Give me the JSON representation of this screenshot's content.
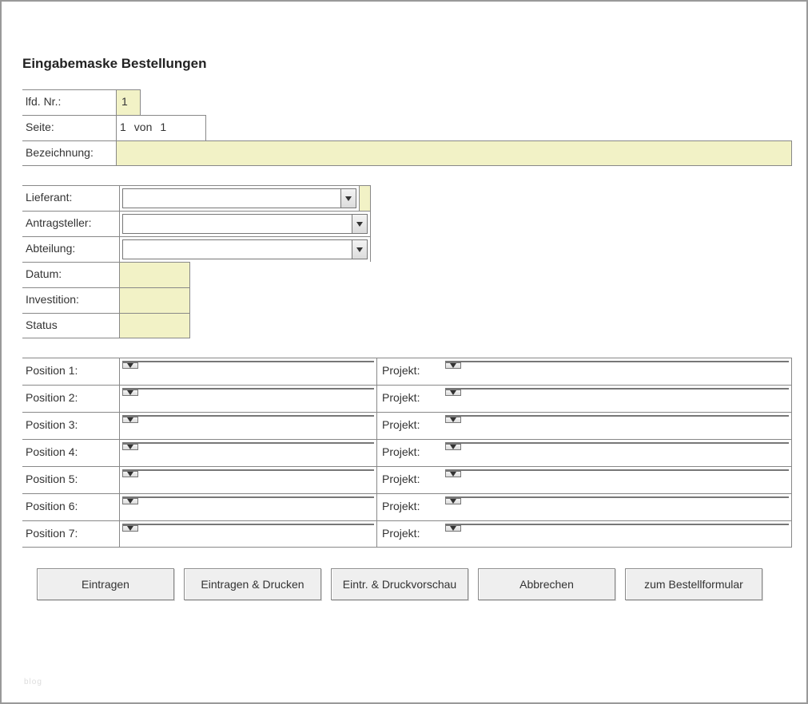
{
  "title": "Eingabemaske Bestellungen",
  "header": {
    "lfd_nr_label": "lfd. Nr.:",
    "lfd_nr_value": "1",
    "seite_label": "Seite:",
    "seite_value": "1",
    "seite_von": "von",
    "seite_total": "1",
    "bezeichnung_label": "Bezeichnung:",
    "bezeichnung_value": ""
  },
  "meta": {
    "lieferant_label": "Lieferant:",
    "lieferant_value": "",
    "antragsteller_label": "Antragsteller:",
    "antragsteller_value": "",
    "abteilung_label": "Abteilung:",
    "abteilung_value": "",
    "datum_label": "Datum:",
    "datum_value": "",
    "investition_label": "Investition:",
    "investition_value": "",
    "status_label": "Status",
    "status_value": ""
  },
  "positions": [
    {
      "pos_label": "Position 1:",
      "pos_value": "",
      "proj_label": "Projekt:",
      "proj_value": ""
    },
    {
      "pos_label": "Position 2:",
      "pos_value": "",
      "proj_label": "Projekt:",
      "proj_value": ""
    },
    {
      "pos_label": "Position 3:",
      "pos_value": "",
      "proj_label": "Projekt:",
      "proj_value": ""
    },
    {
      "pos_label": "Position 4:",
      "pos_value": "",
      "proj_label": "Projekt:",
      "proj_value": ""
    },
    {
      "pos_label": "Position 5:",
      "pos_value": "",
      "proj_label": "Projekt:",
      "proj_value": ""
    },
    {
      "pos_label": "Position 6:",
      "pos_value": "",
      "proj_label": "Projekt:",
      "proj_value": ""
    },
    {
      "pos_label": "Position 7:",
      "pos_value": "",
      "proj_label": "Projekt:",
      "proj_value": ""
    }
  ],
  "buttons": {
    "eintragen": "Eintragen",
    "eintragen_drucken": "Eintragen & Drucken",
    "eintr_druckvorschau": "Eintr. & Druckvorschau",
    "abbrechen": "Abbrechen",
    "zum_bestellformular": "zum Bestellformular"
  },
  "watermark": "blog"
}
